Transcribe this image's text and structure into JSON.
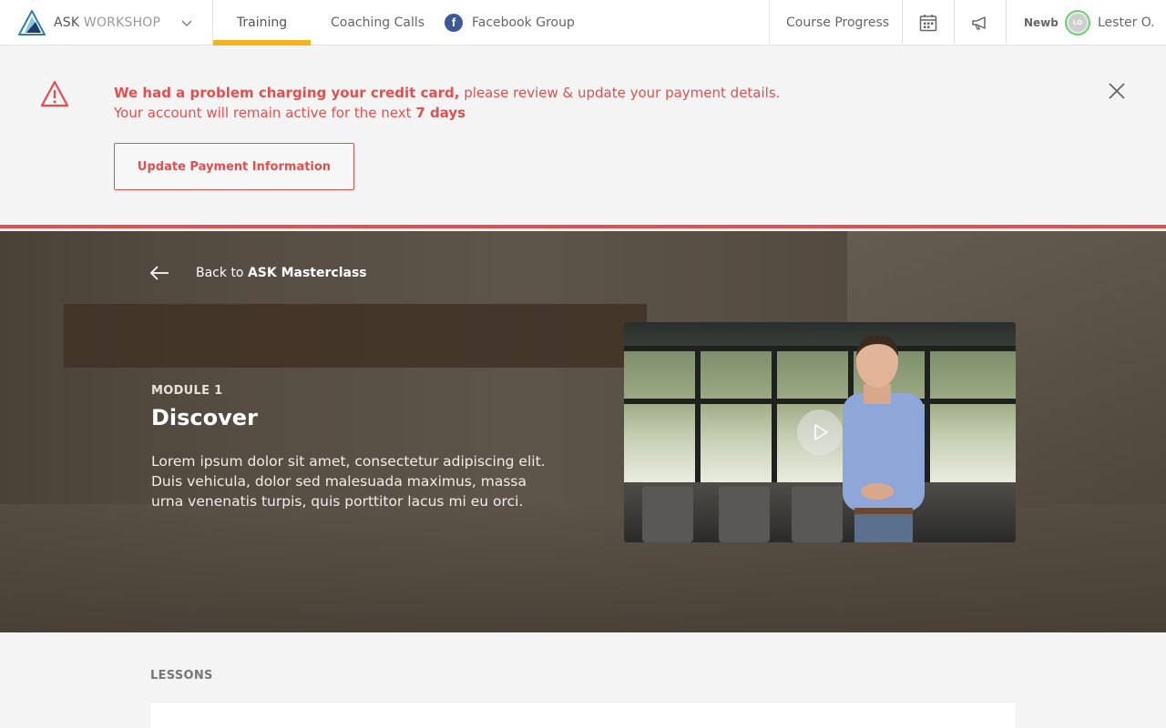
{
  "brand": {
    "ask": "ASK",
    "workshop": "WORKSHOP"
  },
  "nav": {
    "tabs": [
      {
        "label": "Training"
      },
      {
        "label": "Coaching Calls"
      },
      {
        "label": "Facebook Group"
      }
    ],
    "course_progress": "Course Progress",
    "icons": [
      "calendar-icon",
      "megaphone-icon"
    ],
    "user": {
      "rank": "Newb",
      "initials": "LO",
      "name": "Lester O."
    }
  },
  "alert": {
    "bold_text": "We had a problem charging your credit card,",
    "text": " please review & update your payment details. Your account will remain active for the next ",
    "days": "7 days",
    "button": "Update Payment Information"
  },
  "hero": {
    "back_prefix": "Back to ",
    "back_target": "ASK Masterclass",
    "module_label": "MODULE 1",
    "module_title": "Discover",
    "description": "Lorem ipsum dolor sit amet, consectetur adipiscing elit. Duis vehicula, dolor sed malesuada maximus, massa urna venenatis turpis, quis porttitor lacus mi eu orci."
  },
  "lessons": {
    "label": "LESSONS"
  },
  "colors": {
    "accent": "#f5b21b",
    "alert": "#e34f4f",
    "facebook": "#3b5998"
  }
}
